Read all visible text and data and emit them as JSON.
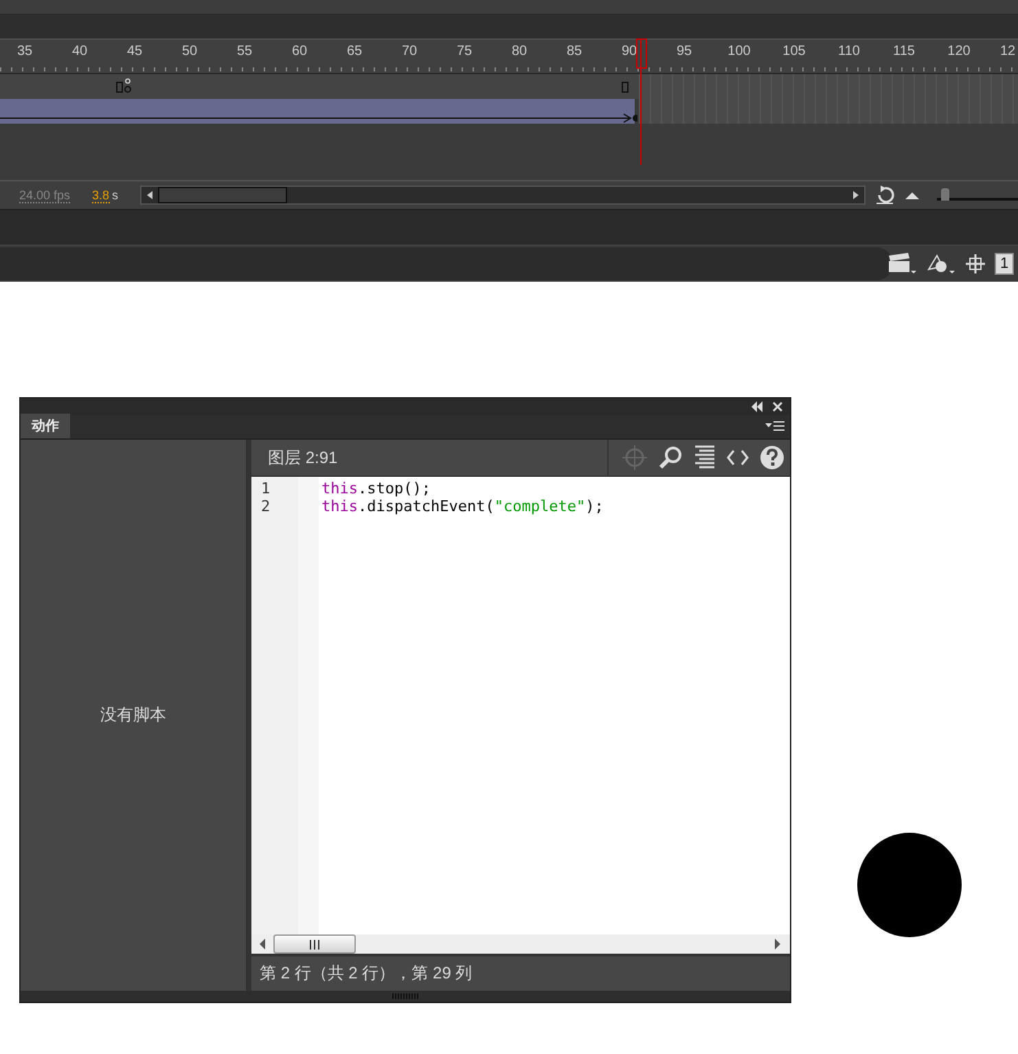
{
  "timeline": {
    "ruler_labels": [
      "35",
      "40",
      "45",
      "50",
      "55",
      "60",
      "65",
      "70",
      "75",
      "80",
      "85",
      "90",
      "95",
      "100",
      "105",
      "110",
      "115",
      "120",
      "12"
    ],
    "fps": "24.00 fps",
    "time_value": "3.8",
    "time_unit": "s",
    "zoom_slider": {
      "level": 0.1
    },
    "frame_field": "1"
  },
  "actions_panel": {
    "tabs": [
      {
        "label": "动作",
        "selected": true
      }
    ],
    "empty_message": "没有脚本",
    "location": "图层 2:91",
    "toolbar": [
      {
        "kind": "target",
        "disabled": true
      },
      {
        "kind": "search",
        "disabled": false
      },
      {
        "kind": "format",
        "disabled": false
      },
      {
        "kind": "code",
        "disabled": false
      },
      {
        "kind": "help",
        "disabled": false
      }
    ],
    "code_lines": [
      {
        "number": "1",
        "tokens": [
          {
            "kind": "keyword",
            "text": "this"
          },
          {
            "kind": "plain",
            "text": ".stop();"
          }
        ]
      },
      {
        "number": "2",
        "tokens": [
          {
            "kind": "keyword",
            "text": "this"
          },
          {
            "kind": "plain",
            "text": ".dispatchEvent("
          },
          {
            "kind": "string",
            "text": "\"complete\""
          },
          {
            "kind": "plain",
            "text": ");"
          }
        ]
      }
    ],
    "status": "第 2 行（共 2 行），第 29 列"
  }
}
